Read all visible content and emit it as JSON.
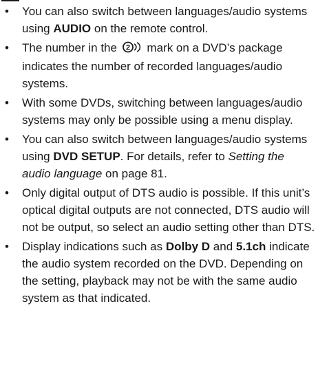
{
  "notes": [
    {
      "parts": [
        {
          "t": "You can also switch between languages/audio systems using "
        },
        {
          "t": "AUDIO",
          "b": true
        },
        {
          "t": " on the remote control."
        }
      ]
    },
    {
      "parts": [
        {
          "t": "The number in the "
        },
        {
          "icon": "audio-language-mark-icon",
          "t": "2"
        },
        {
          "t": " mark on a DVD’s pack­age indicates the number of recorded lan­guages/audio systems."
        }
      ]
    },
    {
      "parts": [
        {
          "t": "With some DVDs, switching between lan­guages/audio systems may only be possible using a menu display."
        }
      ]
    },
    {
      "parts": [
        {
          "t": "You can also switch between languages/audio systems using "
        },
        {
          "t": "DVD SETUP",
          "b": true
        },
        {
          "t": ". For details, refer to "
        },
        {
          "t": "Setting the audio language",
          "i": true
        },
        {
          "t": " on page 81."
        }
      ]
    },
    {
      "parts": [
        {
          "t": "Only digital output of DTS audio is possible. If this unit’s optical digital outputs are not con­nected, DTS audio will not be output, so select an audio setting other than DTS."
        }
      ]
    },
    {
      "parts": [
        {
          "t": "Display indications such as "
        },
        {
          "t": "Dolby D",
          "b": true
        },
        {
          "t": " and "
        },
        {
          "t": "5.1ch",
          "b": true
        },
        {
          "t": " indicate the audio system recorded on the DVD. Depending on the setting, playback may not be with the same audio system as that indicated."
        }
      ]
    }
  ],
  "bullet": "•"
}
